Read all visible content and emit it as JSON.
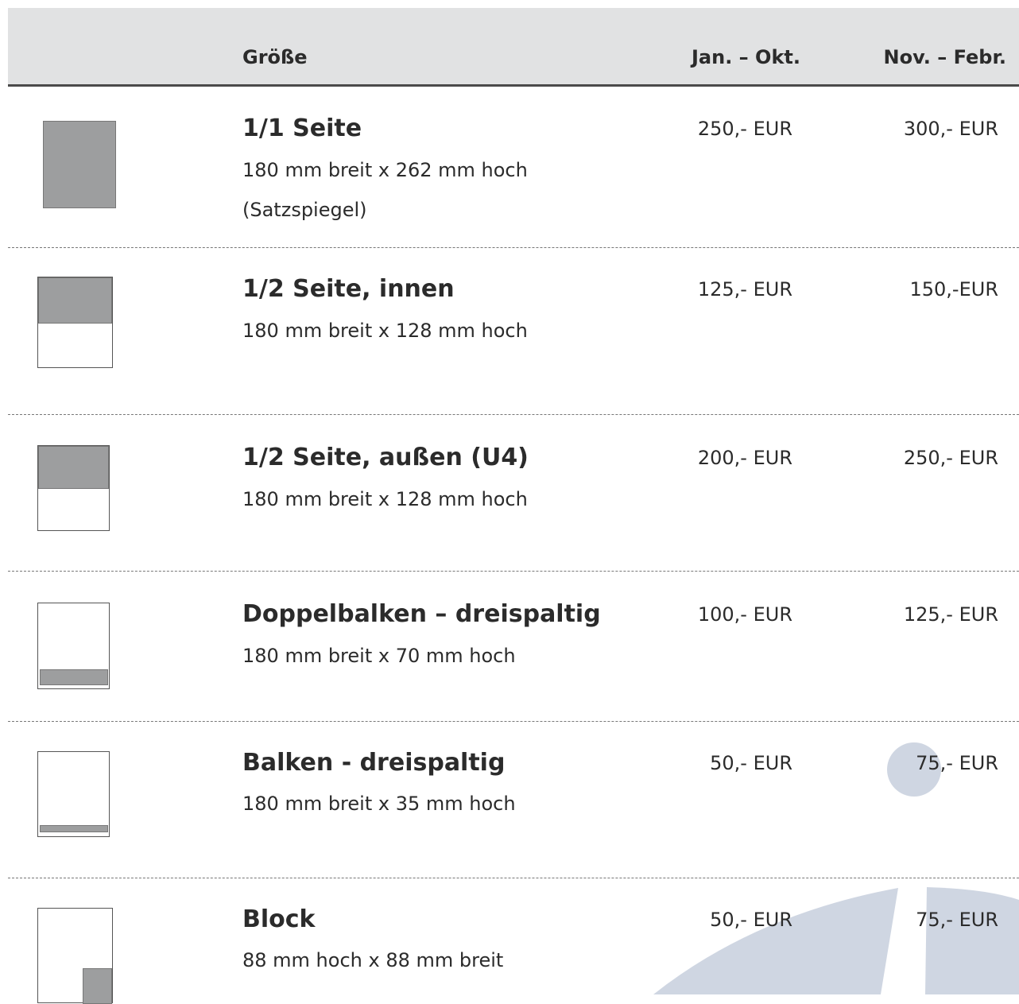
{
  "header": {
    "size_label": "Größe",
    "col1_label": "Jan. – Okt.",
    "col2_label": "Nov. – Febr."
  },
  "rows": [
    {
      "title": "1/1 Seite",
      "sub1": "180 mm breit x 262 mm hoch",
      "sub2": "(Satzspiegel)",
      "price1": "250,- EUR",
      "price2": "300,- EUR",
      "ad_fill": 1.0
    },
    {
      "title": "1/2 Seite, innen",
      "sub1": "180 mm breit x 128 mm hoch",
      "price1": "125,- EUR",
      "price2": "150,-EUR",
      "ad_fill": 0.5
    },
    {
      "title": "1/2 Seite, außen (U4)",
      "sub1": "180 mm breit x 128 mm hoch",
      "price1": "200,- EUR",
      "price2": "250,- EUR",
      "ad_fill": 0.5
    },
    {
      "title": "Doppelbalken – dreispaltig",
      "sub1": "180 mm breit x 70 mm hoch",
      "price1": "100,- EUR",
      "price2": "125,- EUR",
      "ad_fill": 0.2
    },
    {
      "title": "Balken - dreispaltig",
      "sub1": "180 mm breit x 35 mm hoch",
      "price1": "50,- EUR",
      "price2": "75,- EUR",
      "ad_fill": 0.1
    },
    {
      "title": "Block",
      "sub1": "88 mm hoch x 88 mm breit",
      "price1": "50,- EUR",
      "price2": "75,- EUR",
      "ad_fill": 0.3
    }
  ],
  "colors": {
    "header_bg": "#e1e2e3",
    "ad_fill": "#9d9e9f",
    "decor": "#cfd6e2"
  }
}
